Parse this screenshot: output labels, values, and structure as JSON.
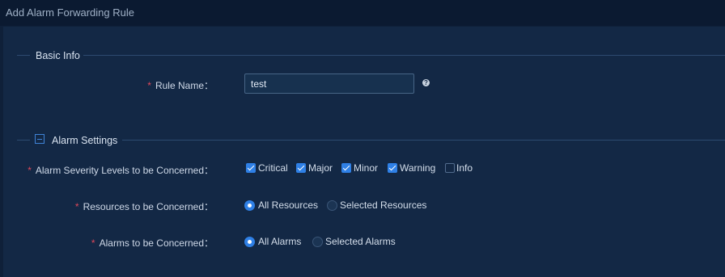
{
  "window": {
    "title": "Add Alarm Forwarding Rule"
  },
  "basic_info": {
    "section_title": "Basic Info",
    "rule_name_label": "Rule Name：",
    "rule_name_value": "test",
    "help_glyph": "?",
    "help_icon": "question-circle-icon"
  },
  "alarm_settings": {
    "section_title": "Alarm Settings",
    "collapse_icon": "minus-square-icon",
    "severity": {
      "label": "Alarm Severity Levels to be Concerned：",
      "options": [
        {
          "label": "Critical",
          "checked": true
        },
        {
          "label": "Major",
          "checked": true
        },
        {
          "label": "Minor",
          "checked": true
        },
        {
          "label": "Warning",
          "checked": true
        },
        {
          "label": "Info",
          "checked": false
        }
      ]
    },
    "resources": {
      "label": "Resources to be Concerned：",
      "options": [
        {
          "label": "All Resources",
          "selected": true
        },
        {
          "label": "Selected Resources",
          "selected": false
        }
      ]
    },
    "alarms": {
      "label": "Alarms to be Concerned：",
      "options": [
        {
          "label": "All Alarms",
          "selected": true
        },
        {
          "label": "Selected Alarms",
          "selected": false
        }
      ]
    }
  },
  "required_mark": "*",
  "colors": {
    "accent": "#2f80e6",
    "required": "#e0485a",
    "background": "#132845"
  }
}
